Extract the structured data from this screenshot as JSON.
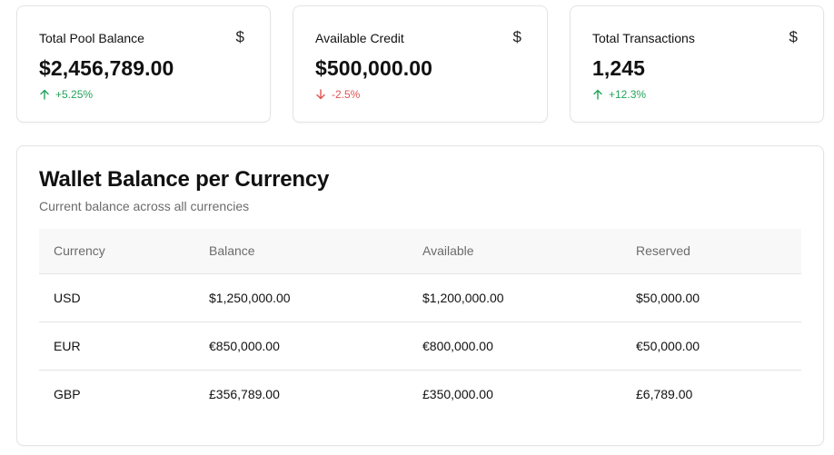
{
  "stats": [
    {
      "title": "Total Pool Balance",
      "icon": "dollar-icon",
      "icon_glyph": "$",
      "value": "$2,456,789.00",
      "change": "+5.25%",
      "trend": "up"
    },
    {
      "title": "Available Credit",
      "icon": "dollar-icon",
      "icon_glyph": "$",
      "value": "$500,000.00",
      "change": "-2.5%",
      "trend": "down"
    },
    {
      "title": "Total Transactions",
      "icon": "dollar-icon",
      "icon_glyph": "$",
      "value": "1,245",
      "change": "+12.3%",
      "trend": "up"
    }
  ],
  "wallet": {
    "title": "Wallet Balance per Currency",
    "subtitle": "Current balance across all currencies",
    "columns": [
      "Currency",
      "Balance",
      "Available",
      "Reserved"
    ],
    "rows": [
      [
        "USD",
        "$1,250,000.00",
        "$1,200,000.00",
        "$50,000.00"
      ],
      [
        "EUR",
        "€850,000.00",
        "€800,000.00",
        "€50,000.00"
      ],
      [
        "GBP",
        "£356,789.00",
        "£350,000.00",
        "£6,789.00"
      ]
    ]
  },
  "colors": {
    "up": "#22a35a",
    "down": "#e05252",
    "border": "#e4e4e7",
    "muted": "#6b6b6b"
  }
}
